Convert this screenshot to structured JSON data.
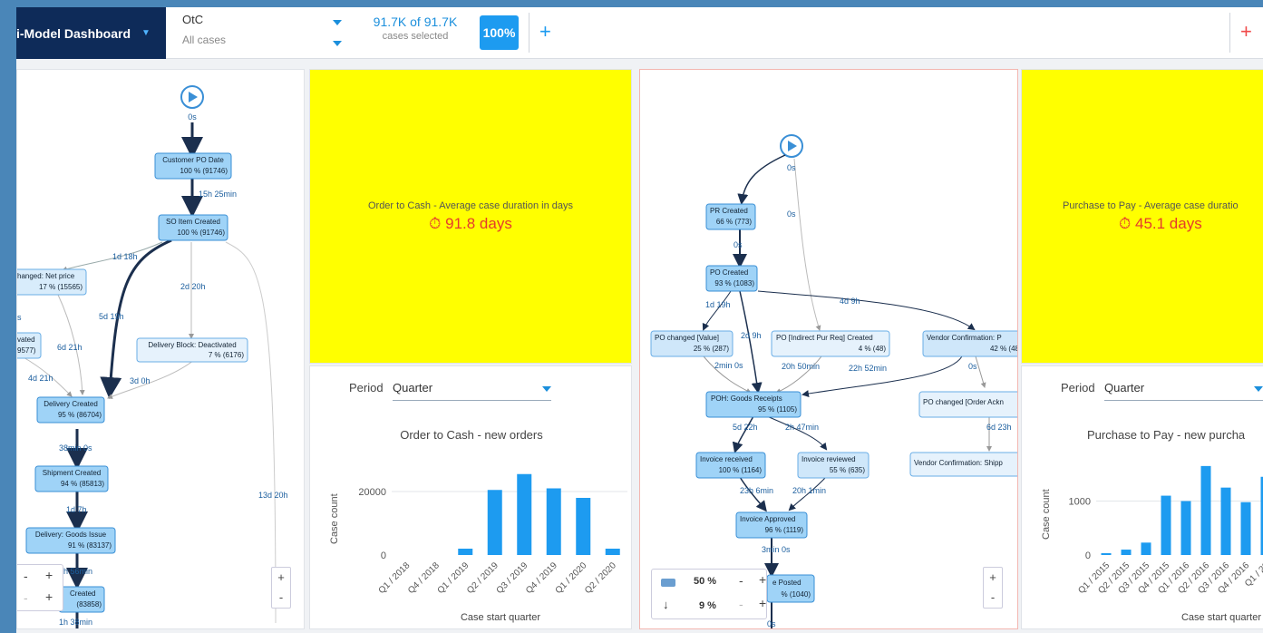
{
  "topbar": {
    "dashboard_title": "i-Model Dashboard",
    "model_name": "OtC",
    "model_filter": "All cases",
    "cases_count": "91.7K of 91.7K",
    "cases_label": "cases selected",
    "cases_pct": "100%",
    "add_label": "+",
    "remove_label": "+"
  },
  "otc_map": {
    "start_edge": "0s",
    "nodes": [
      {
        "title": "Customer PO Date",
        "stat": "100 % (91746)"
      },
      {
        "title": "SO Item Created",
        "stat": "100 % (91746)"
      },
      {
        "title": "hanged: Net price",
        "stat": "17 % (15565)"
      },
      {
        "title": "vated",
        "stat": "9577)"
      },
      {
        "title": "Delivery Block: Deactivated",
        "stat": "7 % (6176)"
      },
      {
        "title": "Delivery Created",
        "stat": "95 % (86704)"
      },
      {
        "title": "Shipment Created",
        "stat": "94 % (85813)"
      },
      {
        "title": "Delivery: Goods Issue",
        "stat": "91 % (83137)"
      },
      {
        "title": "Created",
        "stat": "(83858)"
      }
    ],
    "edges": [
      "15h 25min",
      "1d 18h",
      "2d 20h",
      "5d 19h",
      "s",
      "6d 21h",
      "4d 21h",
      "3d 0h",
      "38min 0s",
      "1d 7h",
      "13d 20h",
      "8h 56min",
      "1h 38min"
    ]
  },
  "otc_kpi": {
    "title": "Order to Cash - Average case duration in days",
    "value": "91.8 days"
  },
  "otc_chart_panel": {
    "period_label": "Period",
    "period_value": "Quarter"
  },
  "p2p_map": {
    "nodes": [
      {
        "title": "PR Created",
        "stat": "66 % (773)"
      },
      {
        "title": "PO Created",
        "stat": "93 % (1083)"
      },
      {
        "title": "PO changed [Value]",
        "stat": "25 % (287)"
      },
      {
        "title": "PO [Indirect Pur Req] Created",
        "stat": "4 % (48)"
      },
      {
        "title": "Vendor Confirmation: P",
        "stat": "42 % (48"
      },
      {
        "title": "POH: Goods Receipts",
        "stat": "95 % (1105)"
      },
      {
        "title": "PO changed [Order Ackn",
        "stat": ""
      },
      {
        "title": "Invoice received",
        "stat": "100 % (1164)"
      },
      {
        "title": "Invoice reviewed",
        "stat": "55 % (635)"
      },
      {
        "title": "Vendor Confirmation: Shipp",
        "stat": ""
      },
      {
        "title": "Invoice Approved",
        "stat": "96 % (1119)"
      },
      {
        "title": "e Posted",
        "stat": "% (1040)"
      }
    ],
    "edges": [
      "0s",
      "0s",
      "0s",
      "1d 19h",
      "4d 9h",
      "2d 9h",
      "2min 0s",
      "20h 50min",
      "22h 52min",
      "0s",
      "5d 22h",
      "2h 47min",
      "6d 23h",
      "23h 6min",
      "20h 1min",
      "3min 0s",
      "0s"
    ],
    "slider_activities": "50 %",
    "slider_paths": "9 %"
  },
  "p2p_kpi": {
    "title": "Purchase to Pay - Average case duratio",
    "value": "45.1 days"
  },
  "p2p_chart_panel": {
    "period_label": "Period",
    "period_value": "Quarter"
  },
  "chart_data": [
    {
      "type": "bar",
      "title": "Order to Cash - new orders",
      "xlabel": "Case start quarter",
      "ylabel": "Case count",
      "categories": [
        "Q1 / 2018",
        "Q4 / 2018",
        "Q1 / 2019",
        "Q2 / 2019",
        "Q3 / 2019",
        "Q4 / 2019",
        "Q1 / 2020",
        "Q2 / 2020"
      ],
      "values": [
        0,
        0,
        2000,
        20500,
        25500,
        21000,
        18000,
        2000
      ],
      "yticks": [
        0,
        20000
      ],
      "ylim": [
        0,
        28000
      ],
      "color": "#1d9bf0"
    },
    {
      "type": "bar",
      "title": "Purchase to Pay - new purcha",
      "xlabel": "Case start quarter",
      "ylabel": "Case count",
      "categories": [
        "Q1 / 2015",
        "Q2 / 2015",
        "Q3 / 2015",
        "Q4 / 2015",
        "Q1 / 2016",
        "Q2 / 2016",
        "Q3 / 2016",
        "Q4 / 2016",
        "Q1 / 20"
      ],
      "values": [
        20,
        100,
        230,
        1100,
        1000,
        1650,
        1250,
        980,
        1450
      ],
      "yticks": [
        0,
        1000
      ],
      "ylim": [
        0,
        1900
      ],
      "color": "#1d9bf0"
    }
  ]
}
